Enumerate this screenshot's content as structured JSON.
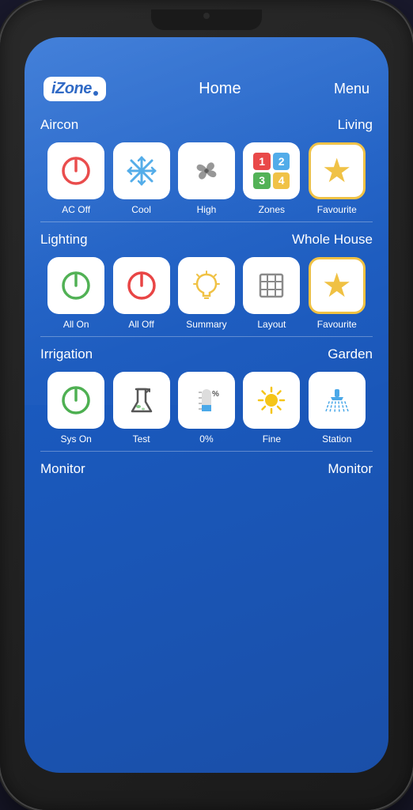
{
  "header": {
    "logo": "iZone",
    "title": "Home",
    "menu": "Menu"
  },
  "sections": [
    {
      "id": "aircon",
      "left_label": "Aircon",
      "right_label": "Living",
      "icons": [
        {
          "id": "ac-off",
          "label": "AC Off",
          "type": "power-red"
        },
        {
          "id": "cool",
          "label": "Cool",
          "type": "snowflake"
        },
        {
          "id": "high",
          "label": "High",
          "type": "fan"
        },
        {
          "id": "zones",
          "label": "Zones",
          "type": "zones"
        },
        {
          "id": "favourite-aircon",
          "label": "Favourite",
          "type": "star"
        }
      ]
    },
    {
      "id": "lighting",
      "left_label": "Lighting",
      "right_label": "Whole House",
      "icons": [
        {
          "id": "all-on",
          "label": "All On",
          "type": "power-green"
        },
        {
          "id": "all-off",
          "label": "All Off",
          "type": "power-red"
        },
        {
          "id": "summary",
          "label": "Summary",
          "type": "bulb"
        },
        {
          "id": "layout",
          "label": "Layout",
          "type": "grid"
        },
        {
          "id": "favourite-lighting",
          "label": "Favourite",
          "type": "star"
        }
      ]
    },
    {
      "id": "irrigation",
      "left_label": "Irrigation",
      "right_label": "Garden",
      "icons": [
        {
          "id": "sys-on",
          "label": "Sys On",
          "type": "power-green"
        },
        {
          "id": "test",
          "label": "Test",
          "type": "flask"
        },
        {
          "id": "zero-percent",
          "label": "0%",
          "type": "moisture"
        },
        {
          "id": "fine",
          "label": "Fine",
          "type": "sun"
        },
        {
          "id": "station",
          "label": "Station",
          "type": "water"
        }
      ]
    }
  ],
  "bottom": {
    "left_label": "Monitor",
    "right_label": "Monitor"
  }
}
